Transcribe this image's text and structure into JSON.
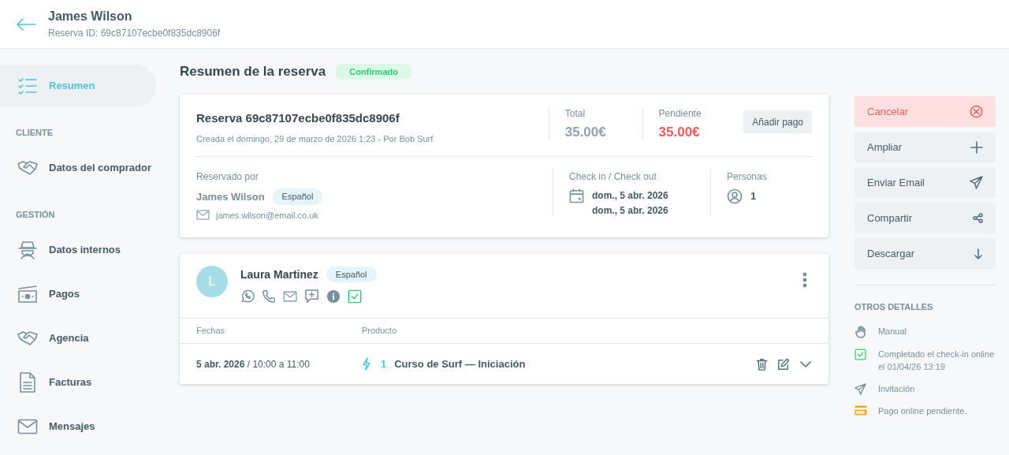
{
  "header": {
    "title": "James Wilson",
    "subtitle": "Reserva ID: 69c87107ecbe0f835dc8906f"
  },
  "sidebar": {
    "items": [
      {
        "kind": "item",
        "label": "Resumen",
        "selected": true
      },
      {
        "kind": "section",
        "label": "CLIENTE"
      },
      {
        "kind": "item",
        "label": "Datos del comprador",
        "selected": false
      },
      {
        "kind": "section",
        "label": "GESTIÓN"
      },
      {
        "kind": "item",
        "label": "Datos internos",
        "selected": false
      },
      {
        "kind": "item",
        "label": "Pagos",
        "selected": false
      },
      {
        "kind": "item",
        "label": "Agencia",
        "selected": false
      },
      {
        "kind": "item",
        "label": "Facturas",
        "selected": false
      },
      {
        "kind": "item",
        "label": "Mensajes",
        "selected": false
      }
    ]
  },
  "summary": {
    "title": "Resumen de la reserva",
    "status": "Confirmado",
    "booking": {
      "title": "Reserva 69c87107ecbe0f835dc8906f",
      "created": "Creada el domingo, 29 de marzo de 2026 1:23 - Por Bob Surf",
      "amounts": [
        {
          "label": "Total",
          "value": "35.00€",
          "kind": "neutral"
        },
        {
          "label": "Pendiente",
          "value": "35.00€",
          "kind": "due"
        }
      ],
      "add_payment_button": "Añadir pago",
      "booked_by_label": "Reservado por",
      "customer_name": "James Wilson",
      "language": "Español",
      "email": "james.wilson@email.co.uk",
      "checkin_label": "Check in / Check out",
      "checkin_dates": [
        "dom., 5 abr. 2026",
        "dom., 5 abr. 2026"
      ],
      "persons_label": "Personas",
      "persons": "1"
    },
    "participant": {
      "initial": "L",
      "name": "Laura Martinez",
      "language": "Español",
      "columns": [
        "Fechas",
        "Producto"
      ],
      "rows": [
        {
          "dates": "**5 abr. 2026** / 10:00 a 11:00",
          "quantity": "1",
          "product": "Curso de Surf — Iniciación"
        }
      ]
    }
  },
  "actions": [
    {
      "label": "Cancelar",
      "kind": "danger"
    },
    {
      "label": "Ampliar",
      "kind": "normal"
    },
    {
      "label": "Enviar Email",
      "kind": "normal"
    },
    {
      "label": "Compartir",
      "kind": "normal"
    },
    {
      "label": "Descargar",
      "kind": "normal"
    }
  ],
  "other_details": {
    "title": "OTROS DETALLES",
    "items": [
      {
        "text": "Manual"
      },
      {
        "text": "Completado el check-in online el 01/04/26 13:19"
      },
      {
        "text": "Invitación"
      },
      {
        "text": "Pago online pendiente."
      }
    ]
  }
}
